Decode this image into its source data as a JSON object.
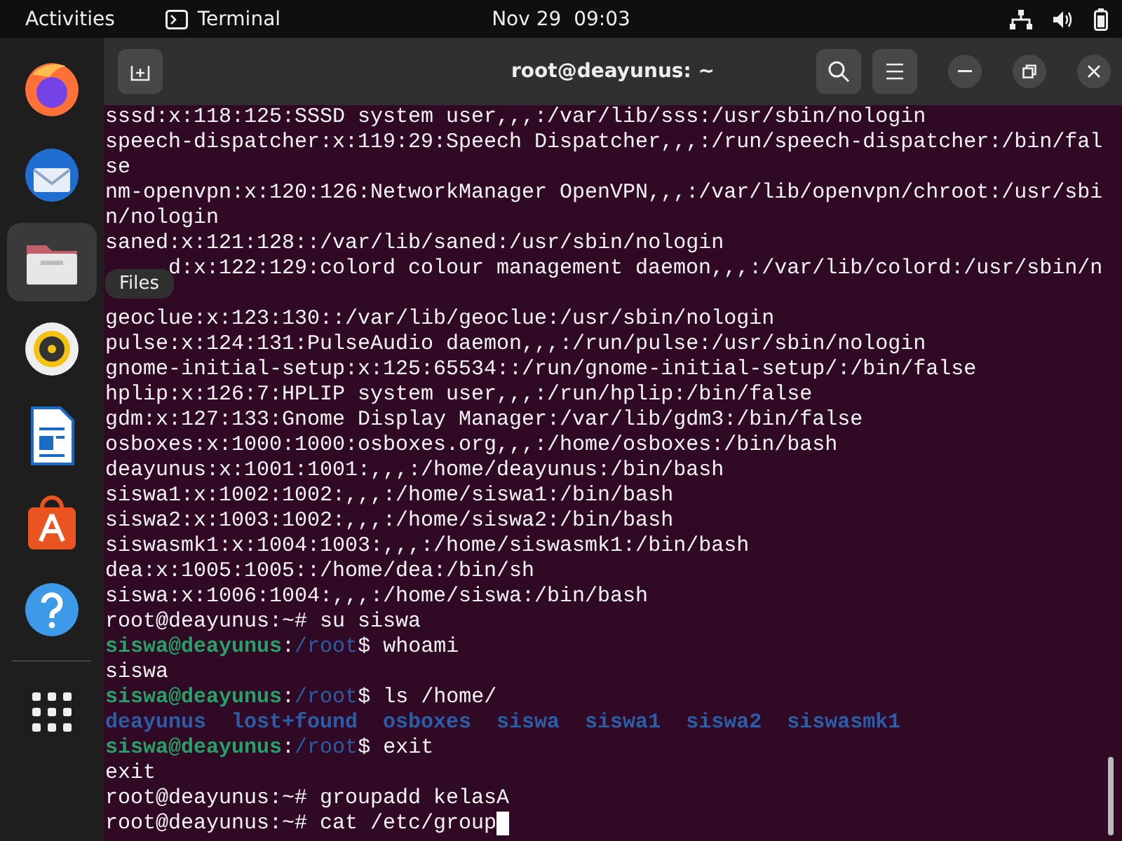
{
  "top_bar": {
    "activities": "Activities",
    "app_name": "Terminal",
    "clock": "Nov 29  09:03"
  },
  "dock": [
    {
      "kind": "firefox",
      "selected": false
    },
    {
      "kind": "thunderbird",
      "selected": false
    },
    {
      "kind": "files",
      "selected": true
    },
    {
      "kind": "rhythmbox",
      "selected": false
    },
    {
      "kind": "writer",
      "selected": false
    },
    {
      "kind": "appcenter",
      "selected": false
    },
    {
      "kind": "help",
      "selected": false
    },
    {
      "kind": "grid",
      "selected": false
    }
  ],
  "tooltip": "Files",
  "window": {
    "title": "root@deayunus: ~"
  },
  "lines": [
    {
      "kind": "text",
      "segments": [
        {
          "kind": "plain",
          "text": "sssd:x:118:125:SSSD system user,,,:/var/lib/sss:/usr/sbin/nologin"
        }
      ]
    },
    {
      "kind": "text",
      "segments": [
        {
          "kind": "plain",
          "text": "speech-dispatcher:x:119:29:Speech Dispatcher,,,:/run/speech-dispatcher:/bin/fal"
        }
      ]
    },
    {
      "kind": "text",
      "segments": [
        {
          "kind": "plain",
          "text": "se"
        }
      ]
    },
    {
      "kind": "text",
      "segments": [
        {
          "kind": "plain",
          "text": "nm-openvpn:x:120:126:NetworkManager OpenVPN,,,:/var/lib/openvpn/chroot:/usr/sbi"
        }
      ]
    },
    {
      "kind": "text",
      "segments": [
        {
          "kind": "plain",
          "text": "n/nologin"
        }
      ]
    },
    {
      "kind": "text",
      "segments": [
        {
          "kind": "plain",
          "text": "saned:x:121:128::/var/lib/saned:/usr/sbin/nologin"
        }
      ]
    },
    {
      "kind": "partial",
      "segments": [
        {
          "kind": "plain",
          "text": "d:x:122:129:colord colour management daemon,,,:/var/lib/colord:/usr/sbin/n"
        }
      ]
    },
    {
      "kind": "covered"
    },
    {
      "kind": "text",
      "segments": [
        {
          "kind": "plain",
          "text": "geoclue:x:123:130::/var/lib/geoclue:/usr/sbin/nologin"
        }
      ]
    },
    {
      "kind": "text",
      "segments": [
        {
          "kind": "plain",
          "text": "pulse:x:124:131:PulseAudio daemon,,,:/run/pulse:/usr/sbin/nologin"
        }
      ]
    },
    {
      "kind": "text",
      "segments": [
        {
          "kind": "plain",
          "text": "gnome-initial-setup:x:125:65534::/run/gnome-initial-setup/:/bin/false"
        }
      ]
    },
    {
      "kind": "text",
      "segments": [
        {
          "kind": "plain",
          "text": "hplip:x:126:7:HPLIP system user,,,:/run/hplip:/bin/false"
        }
      ]
    },
    {
      "kind": "text",
      "segments": [
        {
          "kind": "plain",
          "text": "gdm:x:127:133:Gnome Display Manager:/var/lib/gdm3:/bin/false"
        }
      ]
    },
    {
      "kind": "text",
      "segments": [
        {
          "kind": "plain",
          "text": "osboxes:x:1000:1000:osboxes.org,,,:/home/osboxes:/bin/bash"
        }
      ]
    },
    {
      "kind": "text",
      "segments": [
        {
          "kind": "plain",
          "text": "deayunus:x:1001:1001:,,,:/home/deayunus:/bin/bash"
        }
      ]
    },
    {
      "kind": "text",
      "segments": [
        {
          "kind": "plain",
          "text": "siswa1:x:1002:1002:,,,:/home/siswa1:/bin/bash"
        }
      ]
    },
    {
      "kind": "text",
      "segments": [
        {
          "kind": "plain",
          "text": "siswa2:x:1003:1002:,,,:/home/siswa2:/bin/bash"
        }
      ]
    },
    {
      "kind": "text",
      "segments": [
        {
          "kind": "plain",
          "text": "siswasmk1:x:1004:1003:,,,:/home/siswasmk1:/bin/bash"
        }
      ]
    },
    {
      "kind": "text",
      "segments": [
        {
          "kind": "plain",
          "text": "dea:x:1005:1005::/home/dea:/bin/sh"
        }
      ]
    },
    {
      "kind": "text",
      "segments": [
        {
          "kind": "plain",
          "text": "siswa:x:1006:1004:,,,:/home/siswa:/bin/bash"
        }
      ]
    },
    {
      "kind": "text",
      "segments": [
        {
          "kind": "plain",
          "text": "root@deayunus:~# su siswa"
        }
      ]
    },
    {
      "kind": "text",
      "segments": [
        {
          "kind": "user",
          "text": "siswa@deayunus"
        },
        {
          "kind": "plain",
          "text": ":"
        },
        {
          "kind": "path",
          "text": "/root"
        },
        {
          "kind": "plain",
          "text": "$ whoami"
        }
      ]
    },
    {
      "kind": "text",
      "segments": [
        {
          "kind": "plain",
          "text": "siswa"
        }
      ]
    },
    {
      "kind": "text",
      "segments": [
        {
          "kind": "user",
          "text": "siswa@deayunus"
        },
        {
          "kind": "plain",
          "text": ":"
        },
        {
          "kind": "path",
          "text": "/root"
        },
        {
          "kind": "plain",
          "text": "$ ls /home/"
        }
      ]
    },
    {
      "kind": "text",
      "segments": [
        {
          "kind": "dir",
          "text": "deayunus  lost+found  osboxes  siswa  siswa1  siswa2  siswasmk1"
        }
      ]
    },
    {
      "kind": "text",
      "segments": [
        {
          "kind": "user",
          "text": "siswa@deayunus"
        },
        {
          "kind": "plain",
          "text": ":"
        },
        {
          "kind": "path",
          "text": "/root"
        },
        {
          "kind": "plain",
          "text": "$ exit"
        }
      ]
    },
    {
      "kind": "text",
      "segments": [
        {
          "kind": "plain",
          "text": "exit"
        }
      ]
    },
    {
      "kind": "text",
      "segments": [
        {
          "kind": "plain",
          "text": "root@deayunus:~# groupadd kelasA"
        }
      ]
    },
    {
      "kind": "cursor",
      "segments": [
        {
          "kind": "plain",
          "text": "root@deayunus:~# cat /etc/group"
        }
      ]
    }
  ]
}
